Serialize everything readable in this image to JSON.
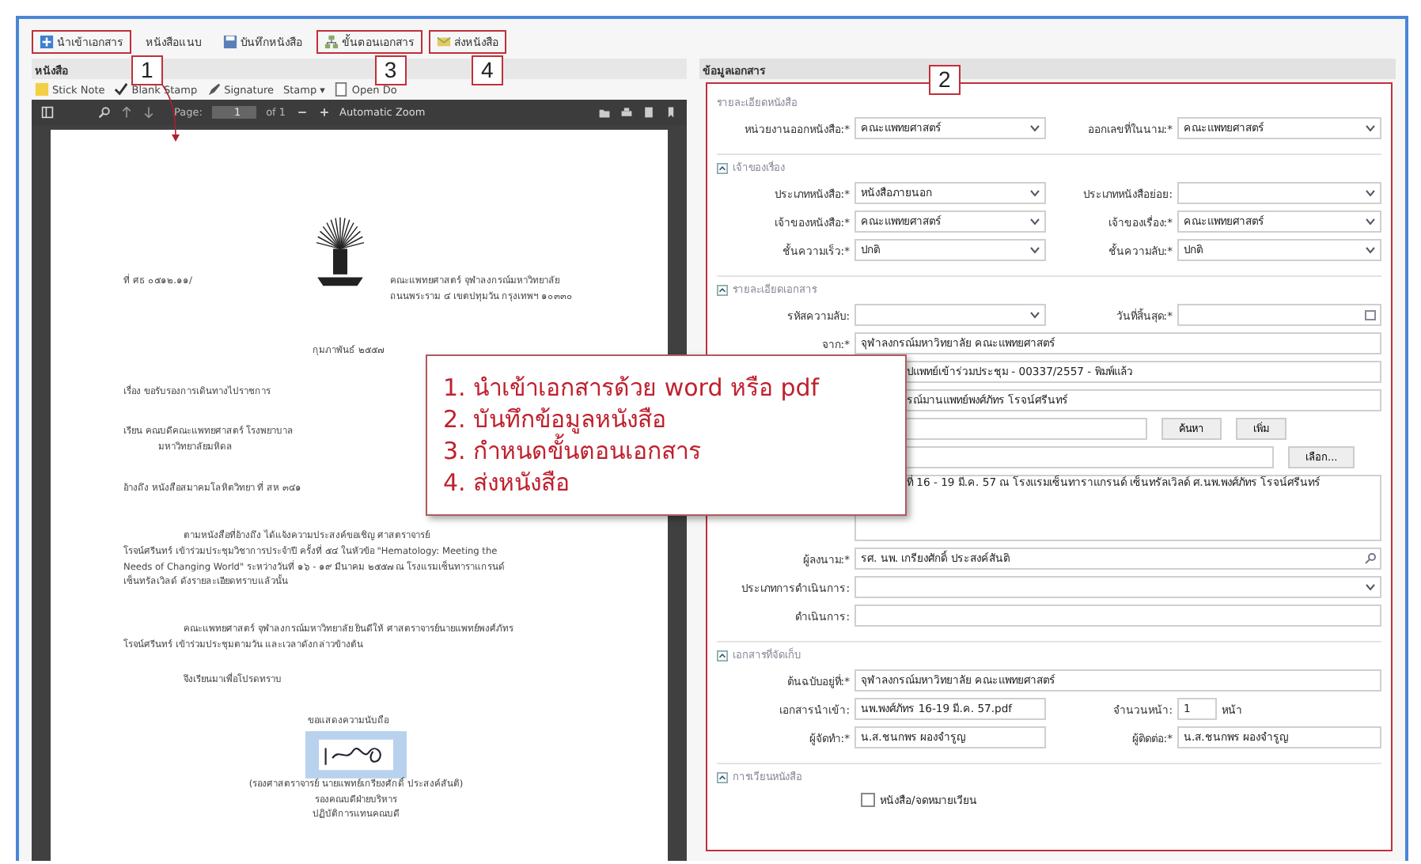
{
  "toolbar": [
    {
      "label": "นำเข้าเอกสาร",
      "highlighted": true,
      "marker": "1"
    },
    {
      "label": "หนังสือแนบ",
      "highlighted": false
    },
    {
      "label": "บันทึกหนังสือ",
      "highlighted": false
    },
    {
      "label": "ขั้นตอนเอกสาร",
      "highlighted": true,
      "marker": "3"
    },
    {
      "label": "ส่งหนังสือ",
      "highlighted": true,
      "marker": "4"
    }
  ],
  "left_panel": {
    "title": "หนังสือ",
    "tools": [
      "Stick Note",
      "Blank Stamp",
      "Signature",
      "Stamp ▾",
      "Open Do"
    ],
    "viewer": {
      "page_label": "Page:",
      "page": "1",
      "of": "of 1",
      "zoom": "Automatic Zoom"
    },
    "letter": {
      "number": "ที่ ศธ ๐๕๑๒.๑๑/",
      "address": [
        "คณะแพทยศาสตร์ จุฬาลงกรณ์มหาวิทยาลัย",
        "ถนนพระราม ๔ เขตปทุมวัน กรุงเทพฯ ๑๐๓๓๐"
      ],
      "date": "กุมภาพันธ์ ๒๕๕๗",
      "lines": [
        {
          "kind": "head",
          "text": "เรื่อง   ขอรับรองการเดินทางไปราชการ"
        },
        {
          "kind": "head",
          "text": "เรียน   คณบดีคณะแพทยศาสตร์ โรงพยาบาล"
        },
        {
          "kind": "cont",
          "text": "มหาวิทยาลัยมหิดล"
        },
        {
          "kind": "head",
          "text": "อ้างถึง  หนังสือสมาคมโลหิตวิทยา ที่ สห ๓๔๑"
        },
        {
          "kind": "para",
          "text": "ตามหนังสือที่อ้างถึง ได้แจ้งความประสงค์ขอเชิญ ศาสตราจารย์"
        },
        {
          "kind": "line",
          "text": "โรจน์ศรีนทร์  เข้าร่วมประชุมวิชาการประจำปี ครั้งที่ ๕๔ ในหัวข้อ \"Hematology: Meeting the"
        },
        {
          "kind": "line",
          "text": "Needs of Changing World\" ระหว่างวันที่ ๑๖ - ๑๙ มีนาคม ๒๕๕๗ ณ โรงแรมเซ็นทาราแกรนด์"
        },
        {
          "kind": "line",
          "text": "เซ็นทรัลเวิลด์ ดังรายละเอียดทราบแล้วนั้น"
        },
        {
          "kind": "para",
          "text": "คณะแพทยศาสตร์ จุฬาลงกรณ์มหาวิทยาลัย ยินดีให้ ศาสตราจารย์นายแพทย์พงศ์ภัทร"
        },
        {
          "kind": "line",
          "text": "โรจน์ศรีนทร์  เข้าร่วมประชุมตามวัน และเวลาดังกล่าวข้างต้น"
        },
        {
          "kind": "para2",
          "text": "จึงเรียนมาเพื่อโปรดทราบ"
        }
      ],
      "closing": "ขอแสดงความนับถือ",
      "signer": [
        "(รองศาสตราจารย์ นายแพทย์เกรียงศักดิ์  ประสงค์สันติ)",
        "รองคณบดีฝ่ายบริหาร",
        "ปฏิบัติการแทนคณบดี"
      ]
    }
  },
  "right_panel": {
    "title": "ข้อมูลเอกสาร",
    "highlighted": true,
    "marker": "2",
    "sections": [
      {
        "legend": "รายละเอียดหนังสือ",
        "rows": [
          [
            {
              "kind": "select",
              "label": "หน่วยงานออกหนังสือ:*",
              "value": "คณะแพทยศาสตร์"
            },
            {
              "kind": "select",
              "label": "ออกเลขที่ในนาม:*",
              "value": "คณะแพทยศาสตร์"
            }
          ]
        ]
      },
      {
        "legend": "เจ้าของเรื่อง",
        "rows": [
          [
            {
              "kind": "select",
              "label": "ประเภทหนังสือ:*",
              "value": "หนังสือภายนอก"
            },
            {
              "kind": "select",
              "label": "ประเภทหนังสือย่อย:"
            }
          ],
          [
            {
              "kind": "select",
              "label": "เจ้าของหนังสือ:*",
              "value": "คณะแพทยศาสตร์"
            },
            {
              "kind": "select",
              "label": "เจ้าของเรื่อง:*",
              "value": "คณะแพทยศาสตร์"
            }
          ],
          [
            {
              "kind": "select",
              "label": "ชั้นความเร็ว:*",
              "value": "ปกติ"
            },
            {
              "kind": "select",
              "label": "ชั้นความลับ:*",
              "value": "ปกติ"
            }
          ]
        ]
      },
      {
        "legend": "รายละเอียดเอกสาร",
        "rows": [
          [
            {
              "kind": "select",
              "label": "รหัสความลับ:"
            },
            {
              "kind": "date",
              "label": "วันที่สิ้นสุด:*"
            }
          ],
          [
            {
              "kind": "text",
              "label": "จาก:*",
              "value": "จุฬาลงกรณ์มหาวิทยาลัย คณะแพทยศาสตร์"
            }
          ],
          [
            {
              "kind": "covered",
              "value": "ปแพทย์เข้าร่วมประชุม - 00337/2557 - พิมพ์แล้ว"
            }
          ],
          [
            {
              "kind": "covered",
              "value": "รณ์มานแพทย์พงศ์ภัทร  โรจน์ศรีนทร์"
            }
          ],
          [
            {
              "kind": "short",
              "buttons": [
                "ค้นหา",
                "เพิ่ม"
              ]
            }
          ],
          [
            {
              "kind": "wide",
              "buttons": [
                "เลือก..."
              ]
            }
          ],
          [
            {
              "kind": "textarea",
              "value": "ที่ 16 - 19 มี.ค. 57 ณ โรงแรมเซ็นทาราแกรนด์ เซ็นทรัลเวิลด์ ศ.นพ.พงศ์ภัทร โรจน์ศรีนทร์"
            }
          ],
          [
            {
              "kind": "search",
              "label": "ผู้ลงนาม:*",
              "value": "รศ. นพ. เกรียงศักดิ์ ประสงค์สันติ"
            }
          ],
          [
            {
              "kind": "select",
              "label": "ประเภทการดำเนินการ:"
            }
          ],
          [
            {
              "kind": "text",
              "label": "ดำเนินการ:"
            }
          ]
        ]
      },
      {
        "legend": "เอกสารที่จัดเก็บ",
        "rows": [
          [
            {
              "kind": "text",
              "label": "ต้นฉบับอยู่ที่:*",
              "value": "จุฬาลงกรณ์มหาวิทยาลัย คณะแพทยศาสตร์"
            }
          ],
          [
            {
              "kind": "text",
              "label": "เอกสารนำเข้า:",
              "value": "นพ.พงศ์ภัทร 16-19 มี.ค. 57.pdf"
            },
            {
              "kind": "count",
              "label": "จำนวนหน้า:",
              "value": "1",
              "unit": "หน้า"
            }
          ],
          [
            {
              "kind": "text",
              "label": "ผู้จัดทำ:*",
              "value": "น.ส.ชนกพร ผองจำรูญ"
            },
            {
              "kind": "text",
              "label": "ผู้ติดต่อ:*",
              "value": "น.ส.ชนกพร ผองจำรูญ"
            }
          ]
        ]
      },
      {
        "legend": "การเวียนหนังสือ",
        "rows": [
          [
            {
              "kind": "checkbox",
              "label": "หนังสือ/จดหมายเวียน",
              "checked": false
            }
          ]
        ]
      }
    ]
  },
  "callout": [
    "1. นำเข้าเอกสารด้วย word หรือ pdf",
    "2. บันทึกข้อมูลหนังสือ",
    "3. กำหนดขั้นตอนเอกสาร",
    "4. ส่งหนังสือ"
  ]
}
